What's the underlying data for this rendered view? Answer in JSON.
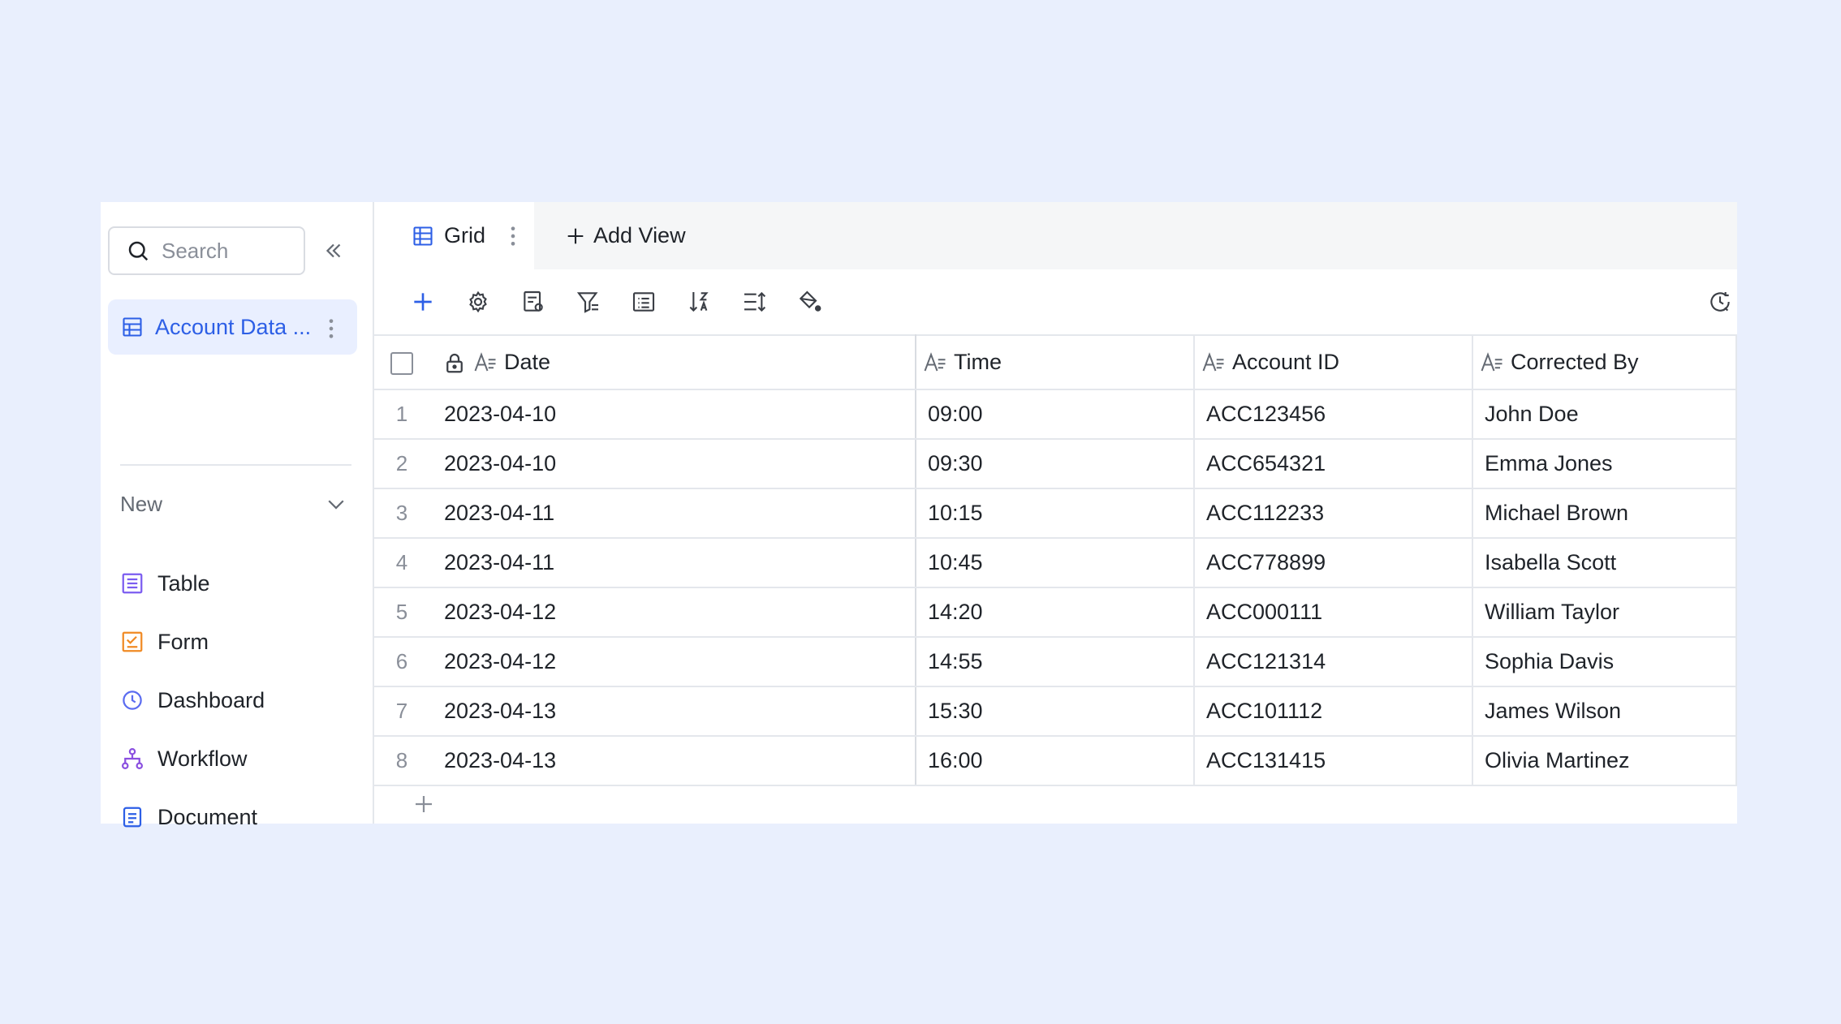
{
  "sidebar": {
    "search_placeholder": "Search",
    "active_item": "Account Data ...",
    "new_label": "New",
    "new_items": [
      {
        "label": "Table",
        "icon": "table-icon"
      },
      {
        "label": "Form",
        "icon": "form-icon"
      },
      {
        "label": "Dashboard",
        "icon": "dashboard-icon"
      },
      {
        "label": "Workflow",
        "icon": "workflow-icon"
      },
      {
        "label": "Document",
        "icon": "document-icon"
      }
    ]
  },
  "tabs": {
    "grid_label": "Grid",
    "add_view_label": "Add View"
  },
  "toolbar": {
    "icons": [
      "add-icon",
      "settings-icon",
      "field-settings-icon",
      "filter-icon",
      "group-icon",
      "sort-icon",
      "row-height-icon",
      "fill-color-icon",
      "history-icon"
    ]
  },
  "table": {
    "columns": [
      "Date",
      "Time",
      "Account ID",
      "Corrected By"
    ],
    "rows": [
      {
        "num": "1",
        "date": "2023-04-10",
        "time": "09:00",
        "account": "ACC123456",
        "by": "John Doe"
      },
      {
        "num": "2",
        "date": "2023-04-10",
        "time": "09:30",
        "account": "ACC654321",
        "by": "Emma Jones"
      },
      {
        "num": "3",
        "date": "2023-04-11",
        "time": "10:15",
        "account": "ACC112233",
        "by": "Michael Brown"
      },
      {
        "num": "4",
        "date": "2023-04-11",
        "time": "10:45",
        "account": "ACC778899",
        "by": "Isabella Scott"
      },
      {
        "num": "5",
        "date": "2023-04-12",
        "time": "14:20",
        "account": "ACC000111",
        "by": "William Taylor"
      },
      {
        "num": "6",
        "date": "2023-04-12",
        "time": "14:55",
        "account": "ACC121314",
        "by": "Sophia Davis"
      },
      {
        "num": "7",
        "date": "2023-04-13",
        "time": "15:30",
        "account": "ACC101112",
        "by": "James Wilson"
      },
      {
        "num": "8",
        "date": "2023-04-13",
        "time": "16:00",
        "account": "ACC131415",
        "by": "Olivia Martinez"
      }
    ]
  },
  "colors": {
    "accent": "#2d5fe6",
    "background": "#e9effd",
    "active_bg": "#e9efff",
    "table_icon": "#7b5cf0",
    "form_icon": "#f08a24",
    "dashboard_icon": "#5b6cf0",
    "workflow_icon": "#8a4fe0",
    "document_icon": "#2d5fe6"
  }
}
